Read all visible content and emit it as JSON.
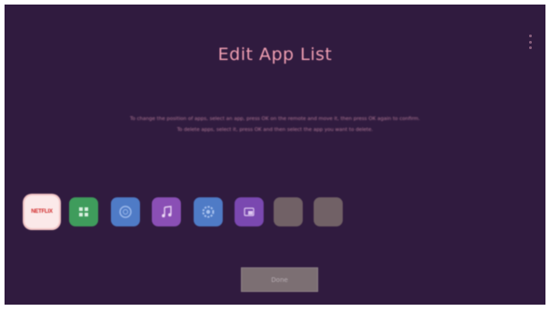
{
  "screen": {
    "title": "Edit App List",
    "instructions": [
      "To change the position of apps, select an app, press OK on the remote and move it, then press OK again to confirm.",
      "To delete apps, select it, press OK and then select the app you want to delete."
    ],
    "done_label": "Done"
  },
  "apps": [
    {
      "name": "Netflix",
      "label": "NETFLIX",
      "icon": "netflix-icon",
      "color": "#fbe9e9",
      "selected": true
    },
    {
      "name": "Apps",
      "icon": "grid-icon",
      "color": "#3f9c5c"
    },
    {
      "name": "Browser",
      "icon": "globe-icon",
      "color": "#4f7bc6"
    },
    {
      "name": "Music",
      "icon": "music-note-icon",
      "color": "#8a4fb5"
    },
    {
      "name": "Settings",
      "icon": "gear-icon",
      "color": "#4f7bc6"
    },
    {
      "name": "Media",
      "icon": "media-icon",
      "color": "#7a48b0"
    },
    {
      "name": "Empty",
      "icon": "blank-icon",
      "color": "#716166"
    },
    {
      "name": "Empty",
      "icon": "blank-icon",
      "color": "#716166"
    }
  ],
  "colors": {
    "background": "#301b3f",
    "title": "#ef9fb2",
    "button": "#7c6f73"
  }
}
